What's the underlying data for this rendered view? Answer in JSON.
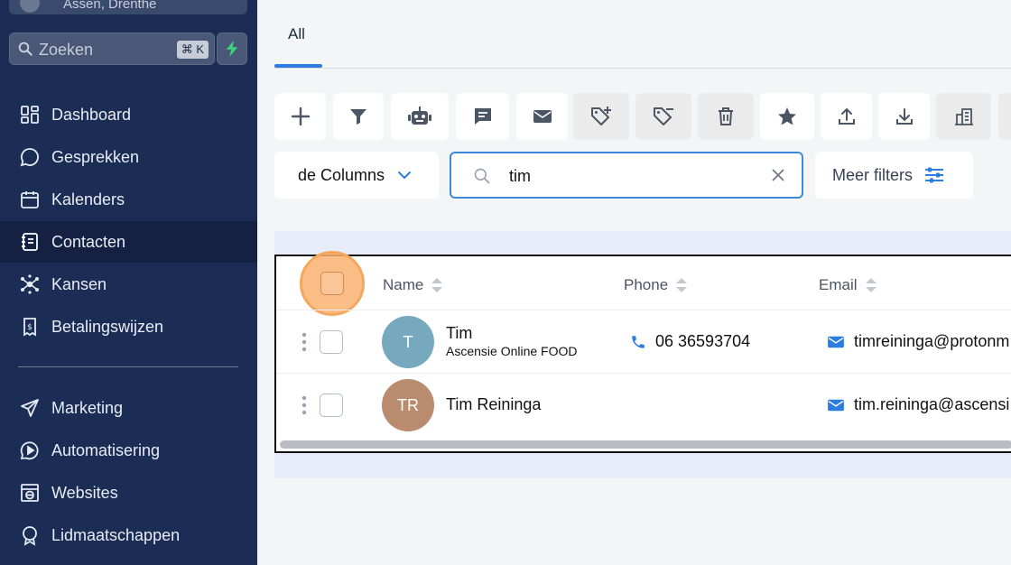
{
  "sidebar": {
    "location": "Assen, Drenthe",
    "search_placeholder": "Zoeken",
    "search_shortcut": "⌘ K",
    "nav": [
      {
        "label": "Dashboard",
        "icon": "dashboard-icon"
      },
      {
        "label": "Gesprekken",
        "icon": "chat-bubble-icon"
      },
      {
        "label": "Kalenders",
        "icon": "calendar-icon"
      },
      {
        "label": "Contacten",
        "icon": "contact-book-icon",
        "active": true
      },
      {
        "label": "Kansen",
        "icon": "network-icon"
      },
      {
        "label": "Betalingswijzen",
        "icon": "invoice-icon"
      },
      {
        "label": "Marketing",
        "icon": "send-icon"
      },
      {
        "label": "Automatisering",
        "icon": "automation-icon"
      },
      {
        "label": "Websites",
        "icon": "website-icon"
      },
      {
        "label": "Lidmaatschappen",
        "icon": "badge-icon"
      }
    ]
  },
  "tabs": {
    "active": "All"
  },
  "toolbar": {
    "buttons": [
      "add-icon",
      "filter-icon",
      "robot-icon",
      "message-icon",
      "mail-icon",
      "tag-add-icon",
      "tag-remove-icon",
      "trash-icon",
      "star-icon",
      "upload-icon",
      "download-icon",
      "building-icon"
    ]
  },
  "filters": {
    "columns_label": "de Columns",
    "search_value": "tim",
    "more_filters_label": "Meer filters"
  },
  "table": {
    "headers": {
      "name": "Name",
      "phone": "Phone",
      "email": "Email"
    },
    "rows": [
      {
        "initials": "T",
        "avatar_color": "#76a9be",
        "name": "Tim",
        "company": "Ascensie Online FOOD",
        "phone": "06 36593704",
        "email": "timreininga@protonm"
      },
      {
        "initials": "TR",
        "avatar_color": "#b98b6f",
        "name": "Tim Reininga",
        "company": "",
        "phone": "",
        "email": "tim.reininga@ascensi"
      }
    ]
  },
  "colors": {
    "sidebar": "#1b2d55",
    "accent": "#2b7de0",
    "highlight": "#f6a75e"
  }
}
